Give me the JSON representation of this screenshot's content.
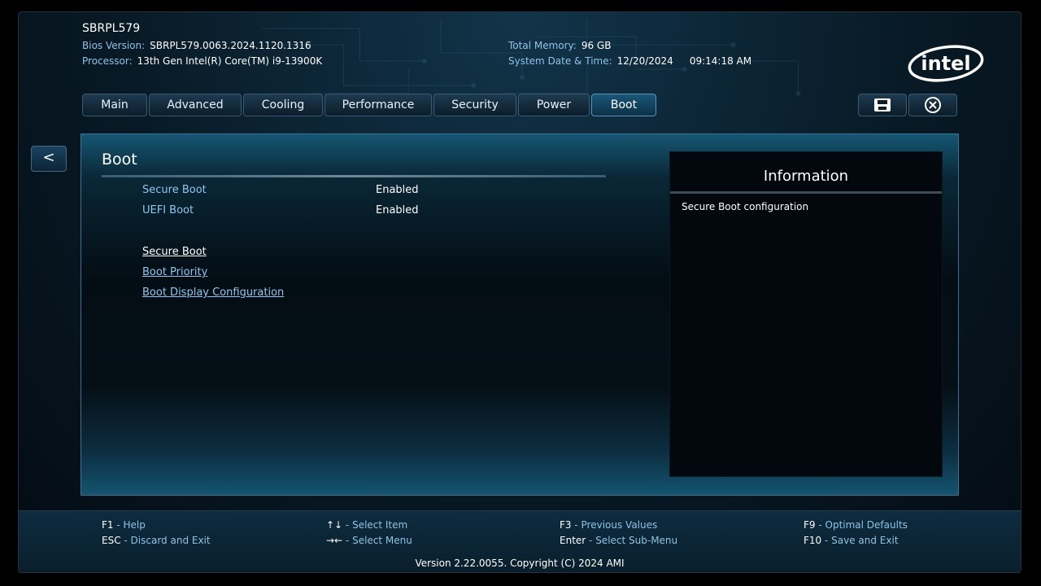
{
  "header": {
    "board": "SBRPL579",
    "bios_version_label": "Bios Version:",
    "bios_version": "SBRPL579.0063.2024.1120.1316",
    "processor_label": "Processor:",
    "processor": "13th Gen Intel(R) Core(TM) i9-13900K",
    "memory_label": "Total Memory:",
    "memory": "96 GB",
    "datetime_label": "System Date & Time:",
    "date": "12/20/2024",
    "time": "09:14:18 AM",
    "logo_text": "intel"
  },
  "tabs": [
    {
      "label": "Main"
    },
    {
      "label": "Advanced"
    },
    {
      "label": "Cooling"
    },
    {
      "label": "Performance"
    },
    {
      "label": "Security"
    },
    {
      "label": "Power"
    },
    {
      "label": "Boot",
      "active": true
    }
  ],
  "toolbar": {
    "save_icon": "save-icon",
    "exit_icon": "close-circle-icon"
  },
  "back": {
    "label": "<"
  },
  "main": {
    "title": "Boot",
    "settings": [
      {
        "label": "Secure Boot",
        "value": "Enabled"
      },
      {
        "label": "UEFI Boot",
        "value": "Enabled"
      }
    ],
    "submenus": [
      {
        "label": "Secure Boot"
      },
      {
        "label": "Boot Priority"
      },
      {
        "label": "Boot Display Configuration"
      }
    ]
  },
  "info": {
    "title": "Information",
    "text": "Secure Boot configuration"
  },
  "footer": {
    "hotkeys": [
      {
        "key": "F1",
        "sep": " - ",
        "desc": "Help"
      },
      {
        "key": "ESC",
        "sep": " - ",
        "desc": "Discard and Exit"
      },
      {
        "key": "↑↓",
        "sep": " - ",
        "desc": "Select Item"
      },
      {
        "key": "→←",
        "sep": " - ",
        "desc": "Select Menu"
      },
      {
        "key": "F3",
        "sep": " - ",
        "desc": "Previous Values"
      },
      {
        "key": "Enter",
        "sep": " - ",
        "desc": "Select Sub-Menu"
      },
      {
        "key": "F9",
        "sep": " - ",
        "desc": "Optimal Defaults"
      },
      {
        "key": "F10",
        "sep": " - ",
        "desc": "Save and Exit"
      }
    ],
    "version": "Version 2.22.0055. Copyright (C) 2024 AMI"
  }
}
